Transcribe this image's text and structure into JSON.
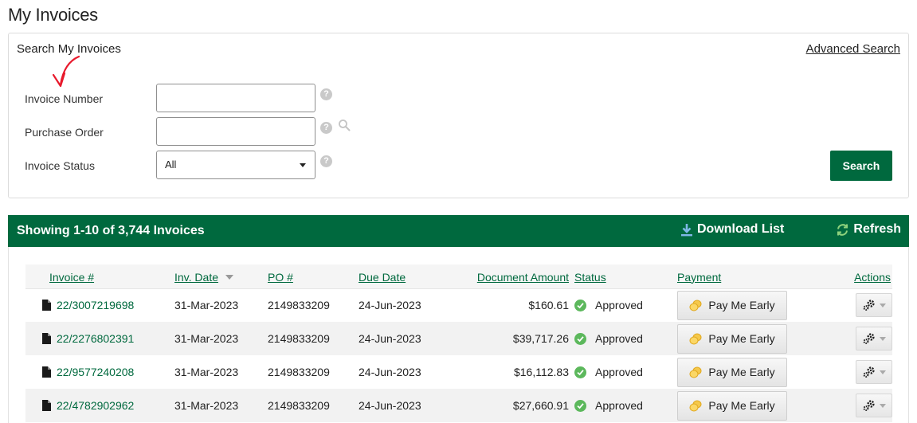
{
  "page": {
    "title": "My Invoices"
  },
  "search": {
    "title": "Search My Invoices",
    "advanced_label": "Advanced Search",
    "fields": {
      "invoice_number": {
        "label": "Invoice Number",
        "value": "",
        "placeholder": ""
      },
      "purchase_order": {
        "label": "Purchase Order",
        "value": "",
        "placeholder": ""
      },
      "invoice_status": {
        "label": "Invoice Status",
        "selected": "All"
      }
    },
    "help_glyph": "?",
    "search_button": "Search"
  },
  "results": {
    "showing": "Showing 1-10 of 3,744 Invoices",
    "download_label": "Download List",
    "refresh_label": "Refresh"
  },
  "table": {
    "columns": {
      "invoice": "Invoice #",
      "inv_date": "Inv. Date",
      "po": "PO #",
      "due_date": "Due Date",
      "amount": "Document Amount",
      "status": "Status",
      "payment": "Payment",
      "actions": "Actions"
    },
    "pay_label": "Pay Me Early",
    "rows": [
      {
        "invoice": "22/3007219698",
        "inv_date": "31-Mar-2023",
        "po": "2149833209",
        "due_date": "24-Jun-2023",
        "amount": "$160.61",
        "status": "Approved"
      },
      {
        "invoice": "22/2276802391",
        "inv_date": "31-Mar-2023",
        "po": "2149833209",
        "due_date": "24-Jun-2023",
        "amount": "$39,717.26",
        "status": "Approved"
      },
      {
        "invoice": "22/9577240208",
        "inv_date": "31-Mar-2023",
        "po": "2149833209",
        "due_date": "24-Jun-2023",
        "amount": "$16,112.83",
        "status": "Approved"
      },
      {
        "invoice": "22/4782902962",
        "inv_date": "31-Mar-2023",
        "po": "2149833209",
        "due_date": "24-Jun-2023",
        "amount": "$27,660.91",
        "status": "Approved"
      }
    ]
  },
  "colors": {
    "brand_green": "#00693e",
    "status_green": "#5cb85c",
    "annotation_red": "#e8192c"
  },
  "icons": {
    "help": "question-circle-icon",
    "lookup": "magnifier-icon",
    "download": "download-arrow-icon",
    "refresh": "refresh-arrows-icon",
    "document": "document-icon",
    "approved": "check-circle-icon",
    "pay": "coins-icon",
    "actions": "gear-icon"
  }
}
